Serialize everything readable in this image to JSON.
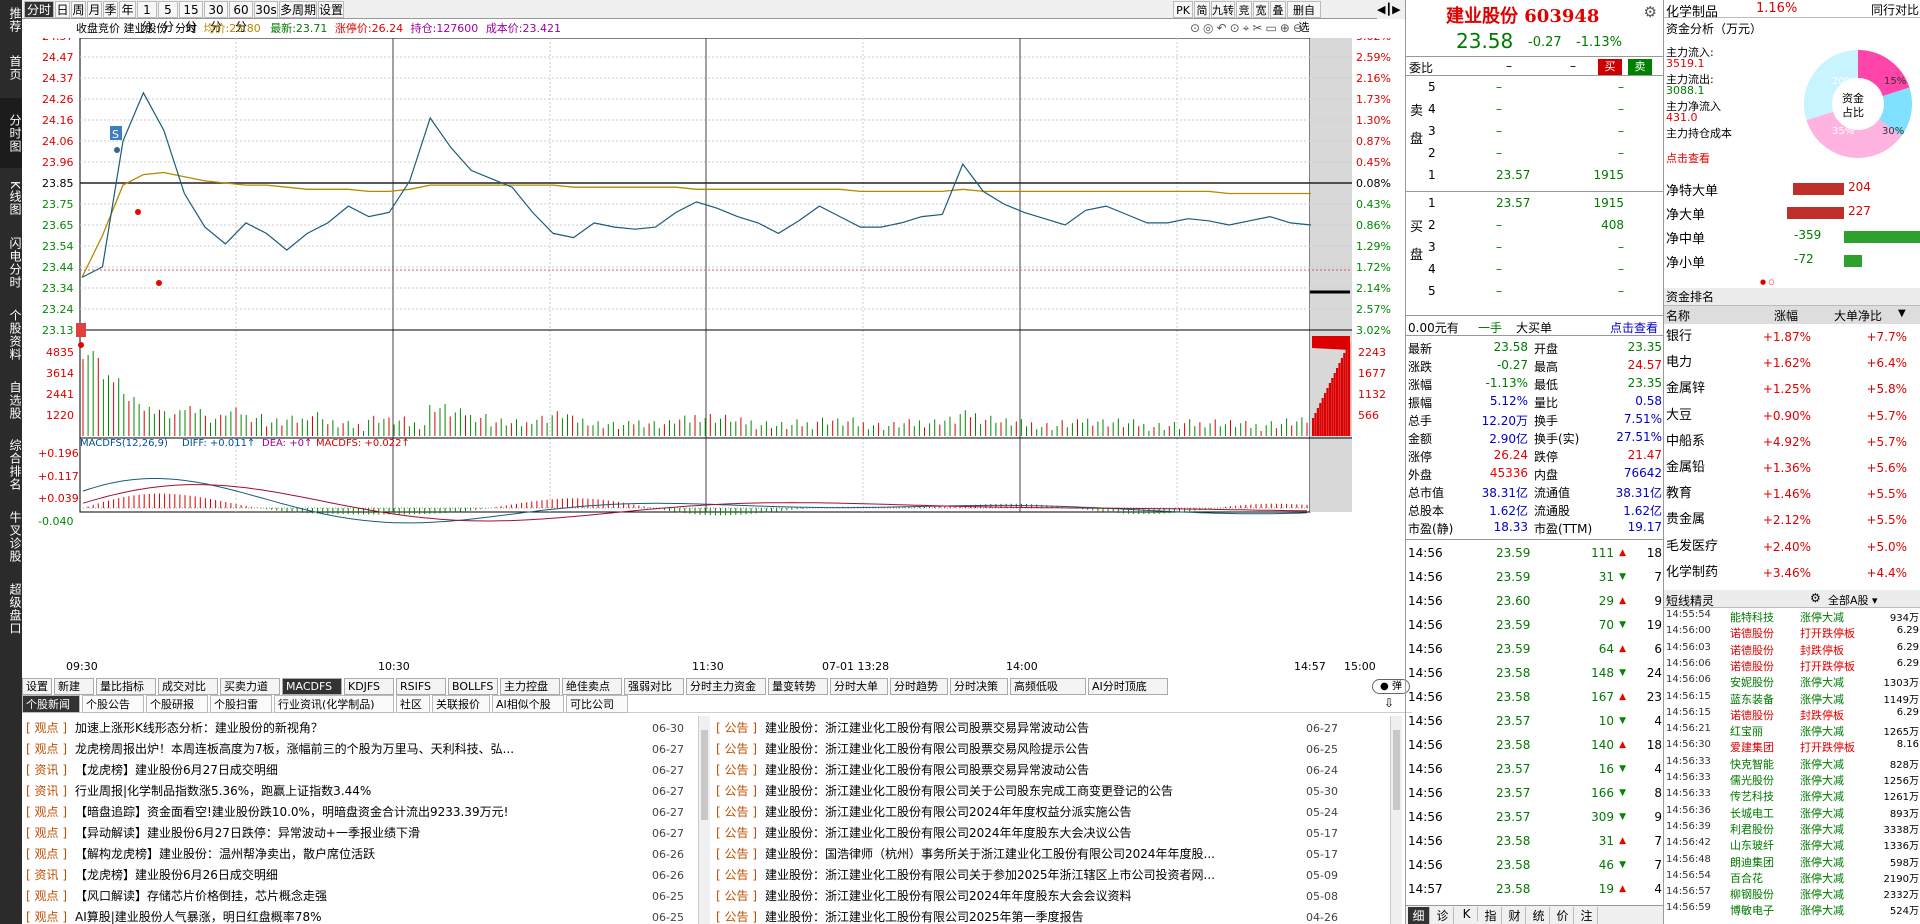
{
  "sidebar": [
    "推荐",
    "首页",
    "分时图",
    "K线图",
    "闪电分时",
    "个股资料",
    "自选股",
    "综合排名",
    "牛叉诊股",
    "超级盘口"
  ],
  "period_tabs": [
    "分时",
    "日",
    "周",
    "月",
    "季",
    "年",
    "1分",
    "5分",
    "15分",
    "30分",
    "60分",
    "30s",
    "多周期",
    "设置"
  ],
  "top_right_buttons": [
    "PK",
    "简",
    "九转",
    "竞",
    "宽",
    "叠",
    "删自选"
  ],
  "info": {
    "name": "收盘竞价 建业股份",
    "time": "分时",
    "avg": "均价:23.80",
    "last": "最新:23.71",
    "limit": "涨停价:26.24",
    "hold": "持仓:127600",
    "cost": "成本价:23.421"
  },
  "chart_data": {
    "type": "line",
    "price_axis": [
      "24.57",
      "24.47",
      "24.37",
      "24.26",
      "24.16",
      "24.06",
      "23.96",
      "23.85",
      "23.75",
      "23.65",
      "23.54",
      "23.44",
      "23.34",
      "23.24",
      "23.13"
    ],
    "pct_axis": [
      "3.02%",
      "2.59%",
      "2.16%",
      "1.73%",
      "1.30%",
      "0.87%",
      "0.45%",
      "0.08%",
      "0.43%",
      "0.86%",
      "1.29%",
      "1.72%",
      "2.14%",
      "2.57%",
      "3.02%"
    ],
    "vol_axis": [
      "4835",
      "3614",
      "2441",
      "1220"
    ],
    "vol_axis_r": [
      "2243",
      "1677",
      "1132",
      "566"
    ],
    "macd_axis": [
      "+0.196",
      "+0.117",
      "+0.039",
      "-0.040"
    ],
    "time_axis": [
      "09:30",
      "10:30",
      "11:30",
      "07-01 13:28",
      "14:00",
      "14:57",
      "15:00"
    ],
    "prev_close": 23.85,
    "price": [
      23.4,
      23.45,
      24.05,
      24.28,
      24.1,
      23.8,
      23.64,
      23.56,
      23.66,
      23.61,
      23.53,
      23.61,
      23.66,
      23.74,
      23.69,
      23.71,
      23.86,
      24.16,
      24.02,
      23.91,
      23.87,
      23.83,
      23.71,
      23.61,
      23.59,
      23.66,
      23.64,
      23.63,
      23.64,
      23.71,
      23.76,
      23.73,
      23.69,
      23.66,
      23.61,
      23.67,
      23.74,
      23.69,
      23.64,
      23.64,
      23.66,
      23.69,
      23.7,
      23.94,
      23.81,
      23.75,
      23.71,
      23.68,
      23.65,
      23.72,
      23.74,
      23.7,
      23.66,
      23.66,
      23.68,
      23.67,
      23.65,
      23.67,
      23.69,
      23.66,
      23.65
    ],
    "avg": [
      23.4,
      23.6,
      23.84,
      23.89,
      23.9,
      23.88,
      23.86,
      23.85,
      23.84,
      23.84,
      23.83,
      23.82,
      23.82,
      23.82,
      23.81,
      23.81,
      23.82,
      23.84,
      23.84,
      23.84,
      23.84,
      23.84,
      23.84,
      23.84,
      23.83,
      23.83,
      23.83,
      23.83,
      23.83,
      23.83,
      23.82,
      23.82,
      23.82,
      23.82,
      23.82,
      23.82,
      23.82,
      23.82,
      23.81,
      23.81,
      23.81,
      23.81,
      23.81,
      23.82,
      23.81,
      23.81,
      23.81,
      23.81,
      23.81,
      23.81,
      23.81,
      23.81,
      23.81,
      23.81,
      23.81,
      23.81,
      23.8,
      23.8,
      23.8,
      23.8,
      23.8
    ]
  },
  "macd_label": {
    "name": "MACDFS(12,26,9)",
    "diff": "DIFF: +0.011↑",
    "dea": "DEA: +0↑",
    "macd": "MACDFS: +0.022↑"
  },
  "indicator_tabs": [
    "设置",
    "新建",
    "量比指标",
    "成交对比",
    "买卖力道",
    "MACDFS",
    "KDJFS",
    "RSIFS",
    "BOLLFS",
    "主力控盘",
    "绝佳卖点",
    "强弱对比",
    "分时主力资金",
    "量变转势",
    "分时大单",
    "分时趋势",
    "分时决策",
    "高频低吸",
    "AI分时顶底"
  ],
  "news_tabs": [
    "个股新闻",
    "个股公告",
    "个股研报",
    "个股扫雷",
    "行业资讯(化学制品)",
    "社区",
    "关联报价",
    "AI相似个股",
    "可比公司"
  ],
  "news_left": [
    [
      "观点",
      "加速上涨形K线形态分析：建业股份的新视角？",
      "06-30"
    ],
    [
      "观点",
      "龙虎榜周报出炉！本周连板高度为7板，涨幅前三的个股为万里马、天利科技、弘...",
      "06-27"
    ],
    [
      "资讯",
      "【龙虎榜】建业股份6月27日成交明细",
      "06-27"
    ],
    [
      "资讯",
      "行业周报|化学制品指数涨5.36%，跑赢上证指数3.44%",
      "06-27"
    ],
    [
      "观点",
      "【暗盘追踪】资金面看空!建业股份跌10.0%，明暗盘资金合计流出9233.39万元!",
      "06-27"
    ],
    [
      "观点",
      "【异动解读】建业股份6月27日跌停：异常波动+一季报业绩下滑",
      "06-27"
    ],
    [
      "观点",
      "【解构龙虎榜】建业股份：温州帮净卖出，散户席位活跃",
      "06-26"
    ],
    [
      "资讯",
      "【龙虎榜】建业股份6月26日成交明细",
      "06-26"
    ],
    [
      "观点",
      "【风口解读】存储芯片价格倒挂，芯片概念走强",
      "06-25"
    ],
    [
      "观点",
      "AI算股|建业股份人气暴涨，明日红盘概率78%",
      "06-25"
    ]
  ],
  "news_right": [
    [
      "公告",
      "建业股份：浙江建业化工股份有限公司股票交易异常波动公告",
      "06-27"
    ],
    [
      "公告",
      "建业股份：浙江建业化工股份有限公司股票交易风险提示公告",
      "06-25"
    ],
    [
      "公告",
      "建业股份：浙江建业化工股份有限公司股票交易异常波动公告",
      "06-24"
    ],
    [
      "公告",
      "建业股份：浙江建业化工股份有限公司关于公司股东完成工商变更登记的公告",
      "05-30"
    ],
    [
      "公告",
      "建业股份：浙江建业化工股份有限公司2024年年度权益分派实施公告",
      "05-24"
    ],
    [
      "公告",
      "建业股份：浙江建业化工股份有限公司2024年年度股东大会决议公告",
      "05-17"
    ],
    [
      "公告",
      "建业股份：国浩律师（杭州）事务所关于浙江建业化工股份有限公司2024年年度股...",
      "05-17"
    ],
    [
      "公告",
      "建业股份：浙江建业化工股份有限公司关于参加2025年浙江辖区上市公司投资者网...",
      "05-09"
    ],
    [
      "公告",
      "建业股份：浙江建业化工股份有限公司2024年年度股东大会会议资料",
      "05-08"
    ],
    [
      "公告",
      "建业股份：浙江建业化工股份有限公司2025年第一季度报告",
      "04-26"
    ]
  ],
  "quote": {
    "title": "建业股份 603948",
    "price": "23.58",
    "chg": "-0.27",
    "pct": "-1.13%",
    "weibi": "委比",
    "buy": "买",
    "sell": "卖",
    "sell_rows": [
      [
        "5",
        "–",
        "–"
      ],
      [
        "4",
        "–",
        "–"
      ],
      [
        "3",
        "–",
        "–"
      ],
      [
        "2",
        "–",
        "–"
      ],
      [
        "1",
        "23.57",
        "1915"
      ]
    ],
    "buy_rows": [
      [
        "1",
        "23.57",
        "1915"
      ],
      [
        "2",
        "–",
        "408"
      ],
      [
        "3",
        "–",
        "–"
      ],
      [
        "4",
        "–",
        "–"
      ],
      [
        "5",
        "–",
        "–"
      ]
    ],
    "sell_label": "卖盘",
    "buy_label": "买盘",
    "big_order": [
      "0.00元有",
      "一手",
      "大买单",
      "点击查看"
    ],
    "stats": [
      [
        "最新",
        "23.58",
        "开盘",
        "23.35"
      ],
      [
        "涨跌",
        "-0.27",
        "最高",
        "24.57"
      ],
      [
        "涨幅",
        "-1.13%",
        "最低",
        "23.35"
      ],
      [
        "振幅",
        "5.12%",
        "量比",
        "0.58"
      ],
      [
        "总手",
        "12.20万",
        "换手",
        "7.51%"
      ],
      [
        "金额",
        "2.90亿",
        "换手(实)",
        "27.51%"
      ],
      [
        "涨停",
        "26.24",
        "跌停",
        "21.47"
      ],
      [
        "外盘",
        "45336",
        "内盘",
        "76642"
      ],
      [
        "总市值",
        "38.31亿",
        "流通值",
        "38.31亿"
      ],
      [
        "总股本",
        "1.62亿",
        "流通股",
        "1.62亿"
      ],
      [
        "市盈(静)",
        "18.33",
        "市盈(TTM)",
        "19.17"
      ]
    ],
    "ticks": [
      [
        "14:56",
        "23.59",
        "111",
        "18"
      ],
      [
        "14:56",
        "23.59",
        "31",
        "7"
      ],
      [
        "14:56",
        "23.60",
        "29",
        "9"
      ],
      [
        "14:56",
        "23.59",
        "70",
        "19"
      ],
      [
        "14:56",
        "23.59",
        "64",
        "6"
      ],
      [
        "14:56",
        "23.58",
        "148",
        "24"
      ],
      [
        "14:56",
        "23.58",
        "167",
        "23"
      ],
      [
        "14:56",
        "23.57",
        "10",
        "4"
      ],
      [
        "14:56",
        "23.58",
        "140",
        "18"
      ],
      [
        "14:56",
        "23.57",
        "16",
        "4"
      ],
      [
        "14:56",
        "23.57",
        "166",
        "8"
      ],
      [
        "14:56",
        "23.57",
        "309",
        "9"
      ],
      [
        "14:56",
        "23.58",
        "31",
        "7"
      ],
      [
        "14:56",
        "23.58",
        "46",
        "7"
      ],
      [
        "14:57",
        "23.58",
        "19",
        "4"
      ]
    ],
    "bottom_tabs": [
      "细",
      "诊",
      "K",
      "指",
      "财",
      "统",
      "价",
      "注"
    ]
  },
  "flow": {
    "sector": "化学制品",
    "sector_pct": "1.16%",
    "sector_right": "同行对比",
    "title": "资金分析（万元）",
    "items": [
      [
        "主力流入:",
        "3519.1"
      ],
      [
        "主力流出:",
        "3088.1"
      ],
      [
        "主力净流入",
        "431.0"
      ],
      [
        "主力持仓成本",
        ""
      ]
    ],
    "click": "点击查看",
    "donut_label": "资金占比",
    "donut_pcts": [
      "20%",
      "15%",
      "35%",
      "30%"
    ],
    "bars": [
      [
        "净特大单",
        "204"
      ],
      [
        "净大单",
        "227"
      ],
      [
        "净中单",
        "-359"
      ],
      [
        "净小单",
        "-72"
      ]
    ],
    "rank_title": "资金排名",
    "rank_head": [
      "名称",
      "涨幅",
      "大单净比"
    ],
    "rank": [
      [
        "银行",
        "+1.87%",
        "+7.7%"
      ],
      [
        "电力",
        "+1.62%",
        "+6.4%"
      ],
      [
        "金属锌",
        "+1.25%",
        "+5.8%"
      ],
      [
        "大豆",
        "+0.90%",
        "+5.7%"
      ],
      [
        "中船系",
        "+4.92%",
        "+5.7%"
      ],
      [
        "金属铅",
        "+1.36%",
        "+5.6%"
      ],
      [
        "教育",
        "+1.46%",
        "+5.5%"
      ],
      [
        "贵金属",
        "+2.12%",
        "+5.5%"
      ],
      [
        "毛发医疗",
        "+2.40%",
        "+5.0%"
      ],
      [
        "化学制药",
        "+3.46%",
        "+4.4%"
      ]
    ],
    "spirit_title": "短线精灵",
    "spirit_filter": "全部A股",
    "spirit": [
      [
        "14:55:54",
        "能特科技",
        "涨停大减",
        "934万"
      ],
      [
        "14:56:00",
        "诺德股份",
        "打开跌停板",
        "6.29"
      ],
      [
        "14:56:03",
        "诺德股份",
        "封跌停板",
        "6.29"
      ],
      [
        "14:56:06",
        "诺德股份",
        "打开跌停板",
        "6.29"
      ],
      [
        "14:56:06",
        "安妮股份",
        "涨停大减",
        "1303万"
      ],
      [
        "14:56:15",
        "蓝东装备",
        "涨停大减",
        "1149万"
      ],
      [
        "14:56:15",
        "诺德股份",
        "封跌停板",
        "6.29"
      ],
      [
        "14:56:21",
        "红宝丽",
        "涨停大减",
        "1265万"
      ],
      [
        "14:56:30",
        "爱建集团",
        "打开跌停板",
        "8.16"
      ],
      [
        "14:56:33",
        "快克智能",
        "涨停大减",
        "828万"
      ],
      [
        "14:56:33",
        "儒光股份",
        "涨停大减",
        "1256万"
      ],
      [
        "14:56:33",
        "传艺科技",
        "涨停大减",
        "1261万"
      ],
      [
        "14:56:36",
        "长城电工",
        "涨停大减",
        "893万"
      ],
      [
        "14:56:39",
        "利君股份",
        "涨停大减",
        "3338万"
      ],
      [
        "14:56:42",
        "山东玻纤",
        "涨停大减",
        "1336万"
      ],
      [
        "14:56:48",
        "朗迪集团",
        "涨停大减",
        "598万"
      ],
      [
        "14:56:54",
        "百合花",
        "涨停大减",
        "2190万"
      ],
      [
        "14:56:57",
        "柳钢股份",
        "涨停大减",
        "2332万"
      ],
      [
        "14:56:59",
        "博敏电子",
        "涨停大减",
        "524万"
      ]
    ]
  }
}
